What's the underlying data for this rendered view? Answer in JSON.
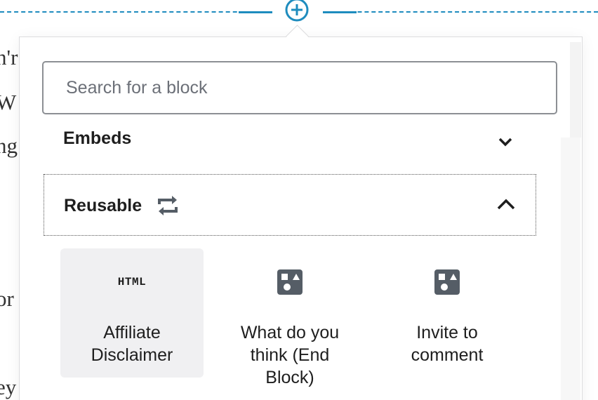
{
  "background_text": [
    "n'r",
    "W",
    "ng",
    "or",
    "ey"
  ],
  "inserter": {
    "add_block_label": "Add block"
  },
  "search": {
    "placeholder": "Search for a block",
    "value": ""
  },
  "panels": {
    "embeds": {
      "title": "Embeds",
      "state": "collapsed"
    },
    "reusable": {
      "title": "Reusable",
      "state": "expanded",
      "blocks": [
        {
          "label": "Affiliate Disclaimer",
          "icon": "html-icon",
          "icon_text": "HTML",
          "selected": true
        },
        {
          "label": "What do you think (End Block)",
          "icon": "block-default-icon",
          "selected": false
        },
        {
          "label": "Invite to comment",
          "icon": "block-default-icon",
          "selected": false
        }
      ]
    }
  },
  "colors": {
    "accent": "#1e8cbe",
    "text": "#1e1e1e",
    "icon": "#555d66",
    "selected_bg": "#f0f0f2"
  }
}
